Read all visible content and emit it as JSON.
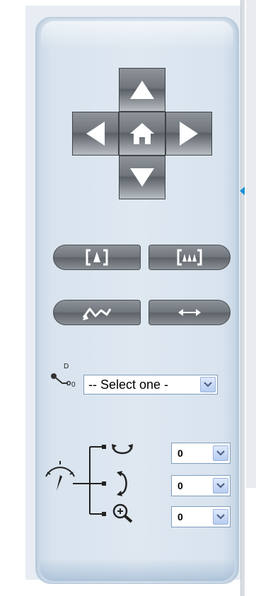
{
  "preset": {
    "select_value": "-- Select one -"
  },
  "speed": {
    "pan_value": "0",
    "tilt_value": "0",
    "zoom_value": "0"
  },
  "icons": {
    "dpad": [
      "arrow-up-icon",
      "arrow-left-icon",
      "home-icon",
      "arrow-right-icon",
      "arrow-down-icon"
    ],
    "pills": [
      "focus-near-icon",
      "focus-far-icon",
      "auto-pan-icon",
      "horizontal-scan-icon"
    ],
    "preset": "preset-point-icon",
    "speed": [
      "speedometer-icon",
      "pan-rotate-icon",
      "tilt-rotate-icon",
      "zoom-in-icon"
    ]
  },
  "colors": {
    "panel": "#dfe8f1",
    "button": "#6f757b",
    "accent": "#1a8fd6"
  }
}
